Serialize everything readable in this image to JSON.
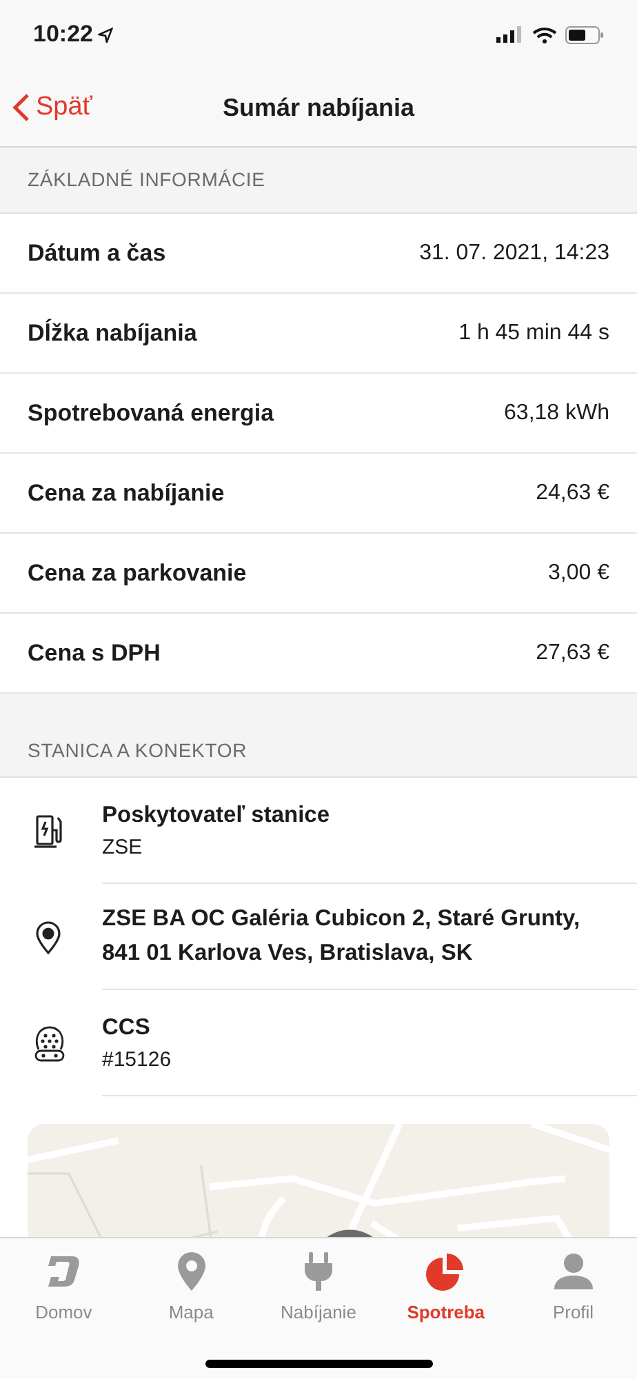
{
  "status_bar": {
    "time": "10:22"
  },
  "nav": {
    "back": "Späť",
    "title": "Sumár nabíjania"
  },
  "basic_section": {
    "header": "ZÁKLADNÉ INFORMÁCIE",
    "rows": [
      {
        "label": "Dátum a čas",
        "value": "31. 07. 2021, 14:23"
      },
      {
        "label": "Dĺžka nabíjania",
        "value": "1 h 45 min 44 s"
      },
      {
        "label": "Spotrebovaná energia",
        "value": "63,18 kWh"
      },
      {
        "label": "Cena za nabíjanie",
        "value": "24,63 €"
      },
      {
        "label": "Cena za parkovanie",
        "value": "3,00 €"
      },
      {
        "label": "Cena s DPH",
        "value": "27,63 €"
      }
    ]
  },
  "station_section": {
    "header": "STANICA A KONEKTOR",
    "items": [
      {
        "kind": "provider",
        "title": "Poskytovateľ stanice",
        "subtitle": "ZSE"
      },
      {
        "kind": "location",
        "title": "ZSE BA OC Galéria Cubicon 2, Staré Grunty, 841 01 Karlova Ves, Bratislava, SK"
      },
      {
        "kind": "connector",
        "title": "CCS",
        "subtitle": "#15126"
      }
    ]
  },
  "tab_bar": [
    {
      "kind": "home",
      "label": "Domov",
      "selected": false
    },
    {
      "kind": "map",
      "label": "Mapa",
      "selected": false
    },
    {
      "kind": "charging",
      "label": "Nabíjanie",
      "selected": false
    },
    {
      "kind": "usage",
      "label": "Spotreba",
      "selected": true
    },
    {
      "kind": "profile",
      "label": "Profil",
      "selected": false
    }
  ]
}
